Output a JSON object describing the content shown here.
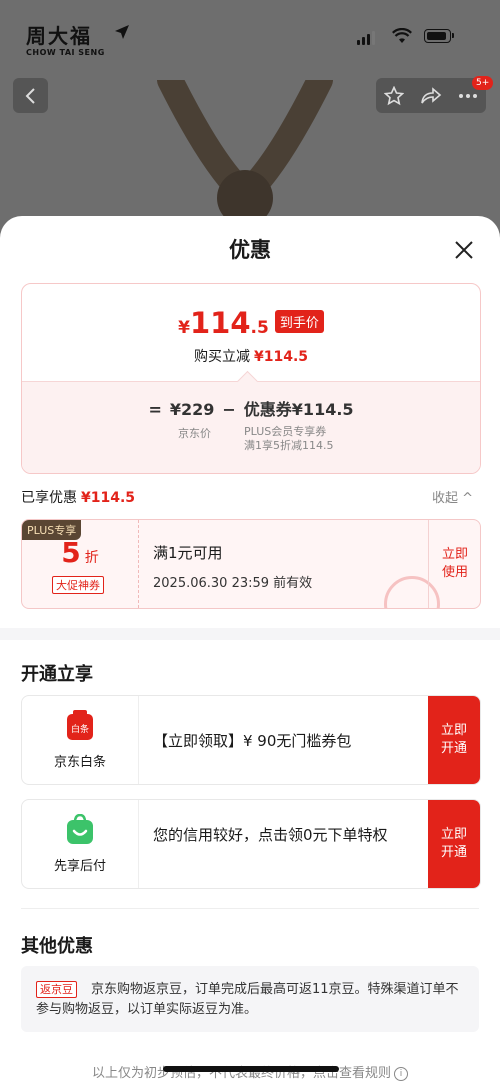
{
  "status_bar": {
    "brand_cn": "周大福",
    "brand_en": "CHOW TAI SENG"
  },
  "nav": {
    "badge": "5+"
  },
  "sheet": {
    "title": "优惠",
    "summary": {
      "currency": "¥",
      "price_int": "114",
      "price_dec": ".5",
      "final_tag": "到手价",
      "instant_label": "购买立减",
      "instant_amount": "¥114.5",
      "calc_equals": "=",
      "calc_price": "¥229",
      "calc_minus": "−",
      "calc_coupon": "优惠券¥114.5",
      "calc_price_label": "京东价",
      "calc_coupon_label1": "PLUS会员专享券",
      "calc_coupon_label2": "满1享5折减114.5"
    },
    "enjoyed_label": "已享优惠",
    "enjoyed_amount": "¥114.5",
    "collapse_label": "收起 ^",
    "coupon": {
      "plus_tag": "PLUS专享",
      "discount_value": "5",
      "discount_unit": "折",
      "promo_tag": "大促神券",
      "condition": "满1元可用",
      "valid_until": "2025.06.30 23:59 前有效",
      "use_label_1": "立即",
      "use_label_2": "使用"
    },
    "open_section": {
      "title": "开通立享",
      "cards": [
        {
          "name": "京东白条",
          "icon_text": "白条",
          "icon": "baitiao-icon",
          "text": "【立即领取】¥ 90无门槛券包",
          "btn1": "立即",
          "btn2": "开通",
          "icon_color": "#e2231a"
        },
        {
          "name": "先享后付",
          "icon": "smile-bag-icon",
          "text": "您的信用较好，点击领0元下单特权",
          "btn1": "立即",
          "btn2": "开通",
          "icon_color": "#3cc36a"
        }
      ]
    },
    "other_section": {
      "title": "其他优惠",
      "tag": "返京豆",
      "text": "京东购物返京豆，订单完成后最高可返11京豆。特殊渠道订单不参与购物返豆，以订单实际返豆为准。"
    },
    "footer_note": "以上仅为初步预估，不代表最终价格，点击查看规则",
    "accent_color": "#e2231a"
  }
}
